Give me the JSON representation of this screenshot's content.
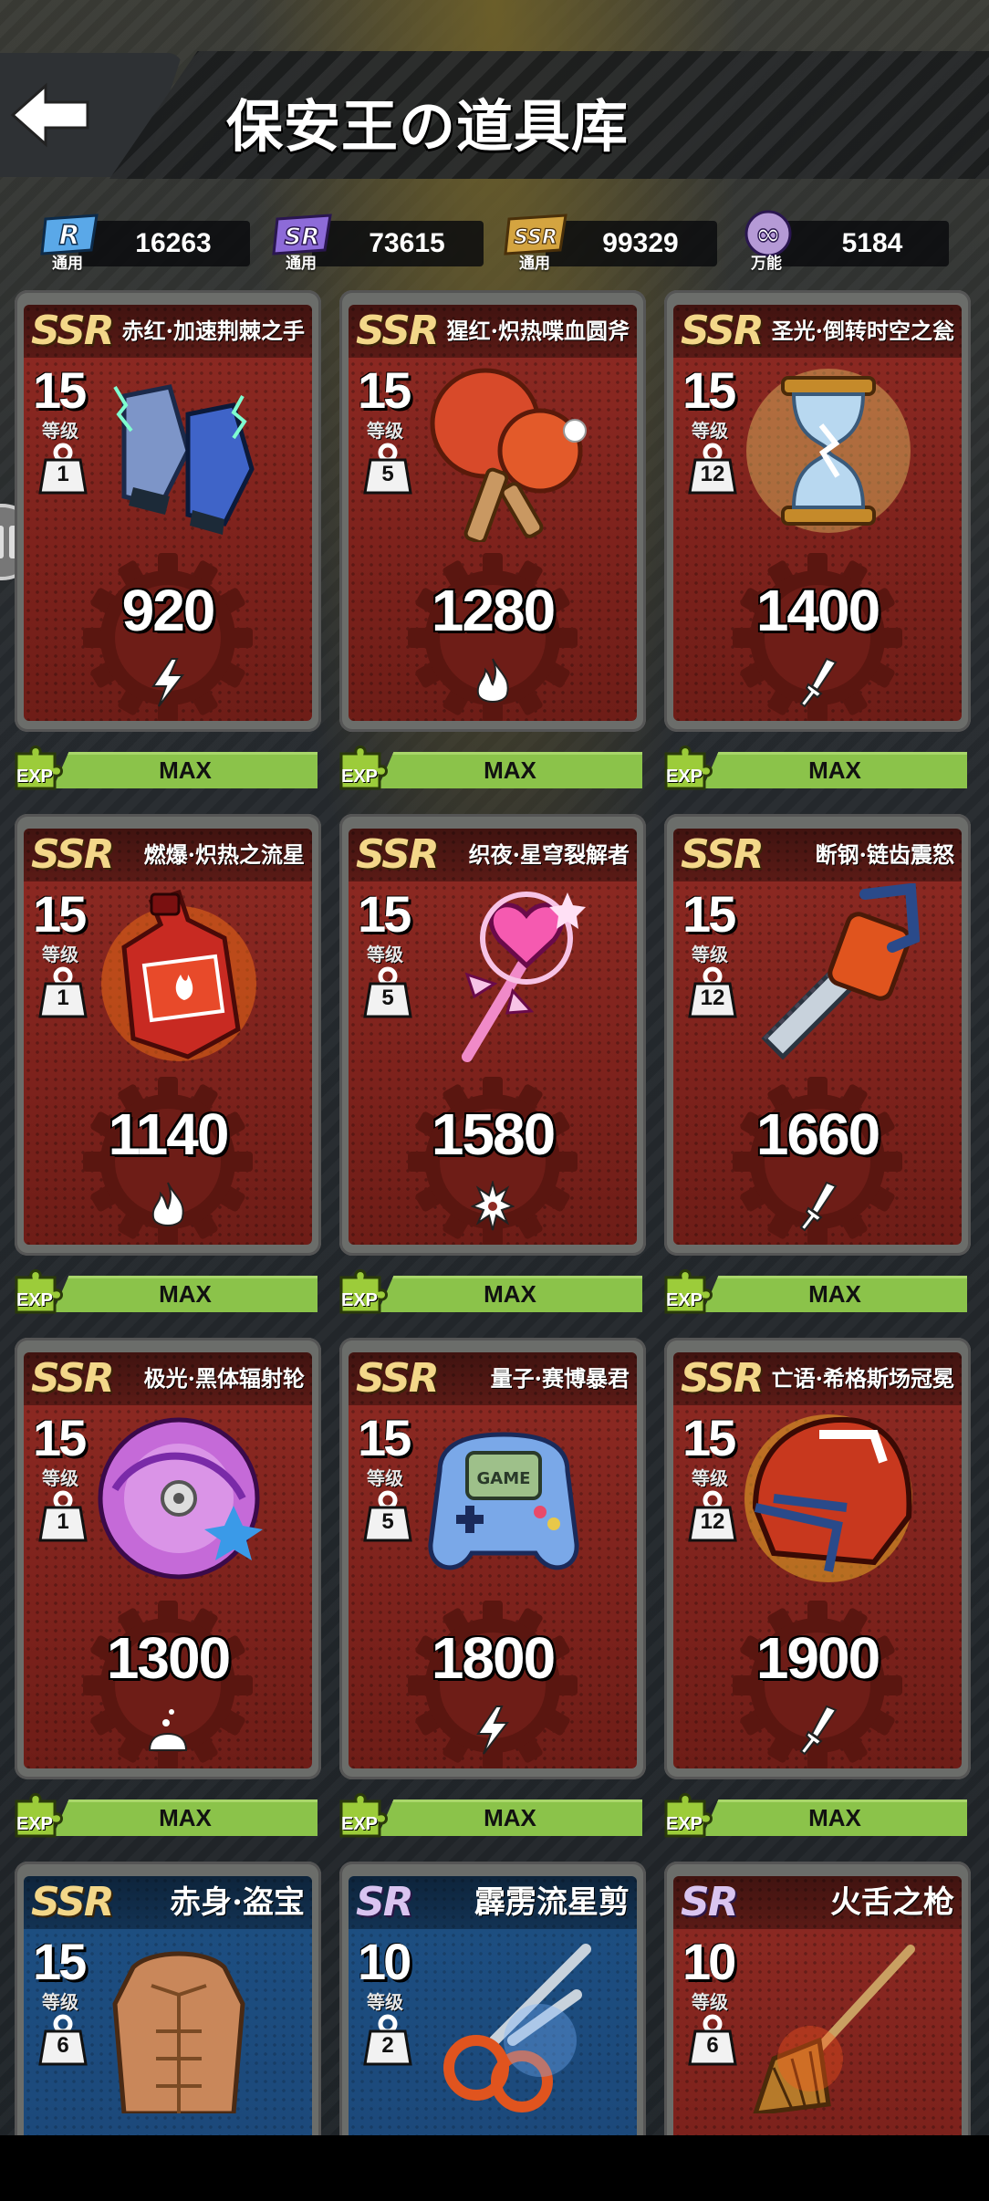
{
  "header": {
    "title": "保安王の道具库"
  },
  "currencies": [
    {
      "badge": "R",
      "sub": "通用",
      "value": "16263",
      "color": "#5aa8e8"
    },
    {
      "badge": "SR",
      "sub": "通用",
      "value": "73615",
      "color": "#8d6bd8"
    },
    {
      "badge": "SSR",
      "sub": "通用",
      "value": "99329",
      "color": "#d4a440"
    },
    {
      "badge": "∞",
      "sub": "万能",
      "value": "5184",
      "color": "#b59ad6"
    }
  ],
  "level_label": "等级",
  "exp": {
    "label": "EXP",
    "max": "MAX"
  },
  "items": [
    {
      "rarity": "SSR",
      "name": "赤红·加速荆棘之手",
      "level": "15",
      "weight": "1",
      "power": "920",
      "type": "lightning-icon",
      "art": "gloves"
    },
    {
      "rarity": "SSR",
      "name": "猩红·炽热喋血圆斧",
      "level": "15",
      "weight": "5",
      "power": "1280",
      "type": "flame-icon",
      "art": "paddles"
    },
    {
      "rarity": "SSR",
      "name": "圣光·倒转时空之瓮",
      "level": "15",
      "weight": "12",
      "power": "1400",
      "type": "sword-icon",
      "art": "hourglass"
    },
    {
      "rarity": "SSR",
      "name": "燃爆·炽热之流星",
      "level": "15",
      "weight": "1",
      "power": "1140",
      "type": "flame-icon",
      "art": "bottle"
    },
    {
      "rarity": "SSR",
      "name": "织夜·星穹裂解者",
      "level": "15",
      "weight": "5",
      "power": "1580",
      "type": "snowflake-icon",
      "art": "wand"
    },
    {
      "rarity": "SSR",
      "name": "断钢·链齿震怒",
      "level": "15",
      "weight": "12",
      "power": "1660",
      "type": "sword-icon",
      "art": "chainsaw"
    },
    {
      "rarity": "SSR",
      "name": "极光·黑体辐射轮",
      "level": "15",
      "weight": "1",
      "power": "1300",
      "type": "poison-icon",
      "art": "disc"
    },
    {
      "rarity": "SSR",
      "name": "量子·赛博暴君",
      "level": "15",
      "weight": "5",
      "power": "1800",
      "type": "lightning-icon",
      "art": "gamepad",
      "art_text": "GAME"
    },
    {
      "rarity": "SSR",
      "name": "亡语·希格斯场冠冕",
      "level": "15",
      "weight": "12",
      "power": "1900",
      "type": "sword-icon",
      "art": "helmet"
    },
    {
      "rarity": "SSR",
      "name": "赤身·盗宝",
      "level": "15",
      "weight": "6",
      "power": "",
      "type": "",
      "art": "torso"
    },
    {
      "rarity": "SR",
      "name": "霹雳流星剪",
      "level": "10",
      "weight": "2",
      "power": "",
      "type": "",
      "art": "scissors"
    },
    {
      "rarity": "SR",
      "name": "火舌之枪",
      "level": "10",
      "weight": "6",
      "power": "",
      "type": "",
      "art": "broom"
    }
  ]
}
